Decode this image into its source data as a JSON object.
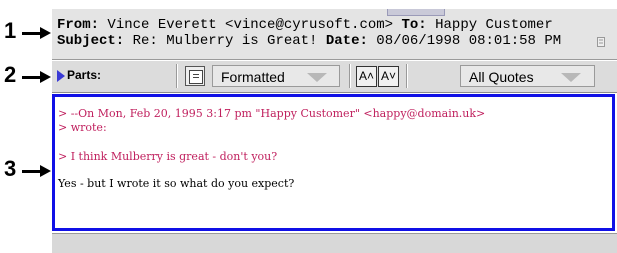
{
  "callouts": [
    "1",
    "2",
    "3"
  ],
  "header": {
    "from_label": "From:",
    "from_value": "Vince Everett <vince@cyrusoft.com>",
    "to_label": "To:",
    "to_value": "Happy Customer",
    "subject_label": "Subject:",
    "subject_value": "Re: Mulberry is Great!",
    "date_label": "Date:",
    "date_value": "08/06/1998 08:01:58 PM"
  },
  "toolbar": {
    "parts_label": "Parts:",
    "format_value": "Formatted",
    "font_up_label": "A˄",
    "font_down_label": "A˅",
    "quotes_value": "All Quotes"
  },
  "message": {
    "lines": [
      {
        "text": "> --On Mon, Feb 20, 1995 3:17 pm \"Happy Customer\" <happy@domain.uk>",
        "kind": "quote"
      },
      {
        "text": "> wrote:",
        "kind": "quote"
      },
      {
        "text": "> I think Mulberry is great - don't you?",
        "kind": "quote"
      },
      {
        "text": "Yes - but I wrote it so what do you expect?",
        "kind": "plain"
      }
    ]
  },
  "colors": {
    "quote": "#c0205e",
    "body_border": "#1010e6",
    "parts_triangle": "#3a3ad6"
  }
}
